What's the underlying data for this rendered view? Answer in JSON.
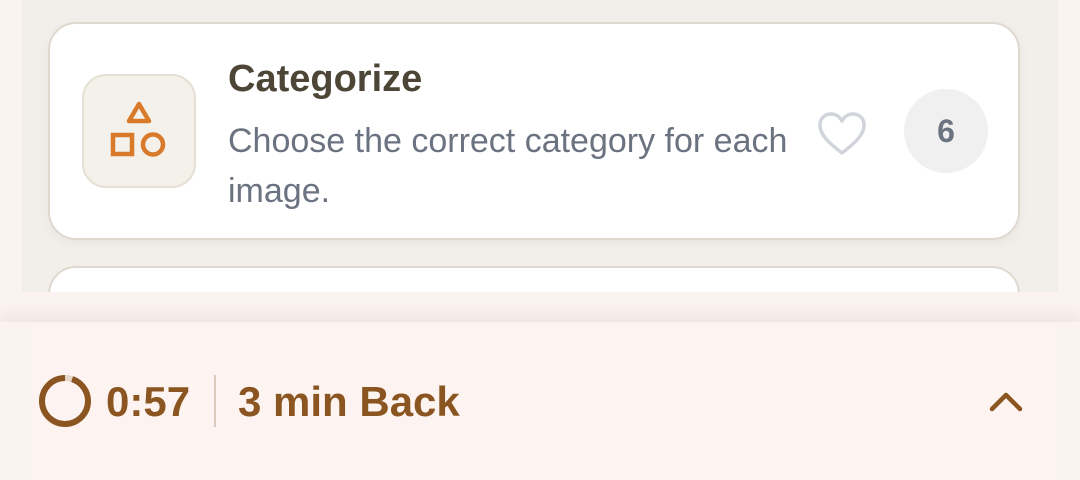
{
  "activity_card": {
    "icon": "shapes-icon",
    "title": "Categorize",
    "description": "Choose the correct category for each image.",
    "favorite_icon": "heart-outline-icon",
    "count": "6"
  },
  "bottom_bar": {
    "timer": "0:57",
    "back_label": "3 min Back",
    "expand_icon": "chevron-up-icon",
    "timer_progress": 0.05
  },
  "colors": {
    "accent_orange": "#d97a2b",
    "timer_brown": "#8a5520",
    "title_dark": "#4d4636",
    "muted_text": "#6b7280"
  }
}
